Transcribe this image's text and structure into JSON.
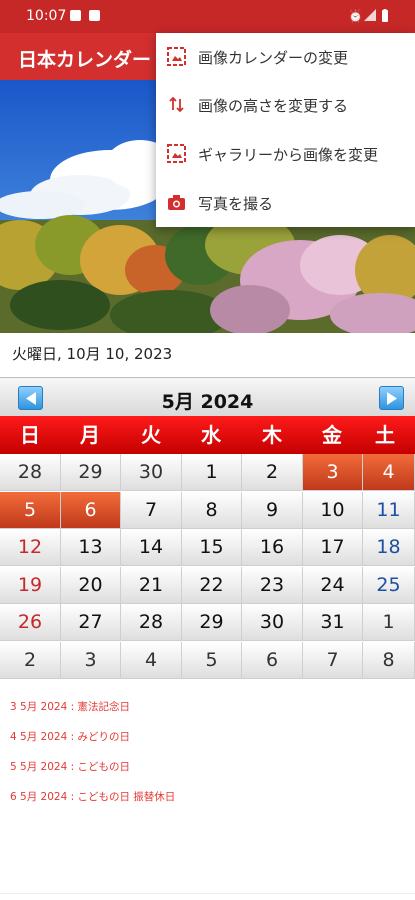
{
  "status_bar": {
    "time": "10:07",
    "left_icons": [
      "folder-icon",
      "check-icon"
    ],
    "right_icons": [
      "alarm-icon",
      "signal-icon",
      "battery-icon"
    ],
    "color": "#c62828"
  },
  "app_bar": {
    "title": "日本カレンダー",
    "color": "#d32f2f"
  },
  "menu": {
    "items": [
      {
        "label": "画像カレンダーの変更",
        "icon": "image-calendar-icon"
      },
      {
        "label": "画像の高さを変更する",
        "icon": "height-arrows-icon"
      },
      {
        "label": "ギャラリーから画像を変更",
        "icon": "gallery-image-icon"
      },
      {
        "label": "写真を撮る",
        "icon": "camera-icon"
      }
    ],
    "icon_color": "#d32f2f"
  },
  "current_date": "火曜日, 10月 10, 2023",
  "calendar": {
    "month_label": "5月  2024",
    "weekdays": [
      "日",
      "月",
      "火",
      "水",
      "木",
      "金",
      "土"
    ],
    "weeks": [
      [
        {
          "d": "28",
          "t": "other"
        },
        {
          "d": "29",
          "t": "other"
        },
        {
          "d": "30",
          "t": "other"
        },
        {
          "d": "1",
          "t": "cur"
        },
        {
          "d": "2",
          "t": "cur"
        },
        {
          "d": "3",
          "t": "hol"
        },
        {
          "d": "4",
          "t": "hol"
        }
      ],
      [
        {
          "d": "5",
          "t": "hol"
        },
        {
          "d": "6",
          "t": "hol"
        },
        {
          "d": "7",
          "t": "cur"
        },
        {
          "d": "8",
          "t": "cur"
        },
        {
          "d": "9",
          "t": "cur"
        },
        {
          "d": "10",
          "t": "cur"
        },
        {
          "d": "11",
          "t": "sat"
        }
      ],
      [
        {
          "d": "12",
          "t": "sun"
        },
        {
          "d": "13",
          "t": "cur"
        },
        {
          "d": "14",
          "t": "cur"
        },
        {
          "d": "15",
          "t": "cur"
        },
        {
          "d": "16",
          "t": "cur"
        },
        {
          "d": "17",
          "t": "cur"
        },
        {
          "d": "18",
          "t": "sat"
        }
      ],
      [
        {
          "d": "19",
          "t": "sun"
        },
        {
          "d": "20",
          "t": "cur"
        },
        {
          "d": "21",
          "t": "cur"
        },
        {
          "d": "22",
          "t": "cur"
        },
        {
          "d": "23",
          "t": "cur"
        },
        {
          "d": "24",
          "t": "cur"
        },
        {
          "d": "25",
          "t": "sat"
        }
      ],
      [
        {
          "d": "26",
          "t": "sun"
        },
        {
          "d": "27",
          "t": "cur"
        },
        {
          "d": "28",
          "t": "cur"
        },
        {
          "d": "29",
          "t": "cur"
        },
        {
          "d": "30",
          "t": "cur"
        },
        {
          "d": "31",
          "t": "cur"
        },
        {
          "d": "1",
          "t": "other"
        }
      ],
      [
        {
          "d": "2",
          "t": "other"
        },
        {
          "d": "3",
          "t": "other"
        },
        {
          "d": "4",
          "t": "other"
        },
        {
          "d": "5",
          "t": "other"
        },
        {
          "d": "6",
          "t": "other"
        },
        {
          "d": "7",
          "t": "other"
        },
        {
          "d": "8",
          "t": "other"
        }
      ]
    ],
    "holiday_color": "#e0542a",
    "header_color": "#d50000"
  },
  "holidays": [
    "3 5月 2024 : 憲法記念日",
    "4 5月 2024 : みどりの日",
    "5 5月 2024 : こどもの日",
    "6 5月 2024 : こどもの日 振替休日"
  ]
}
